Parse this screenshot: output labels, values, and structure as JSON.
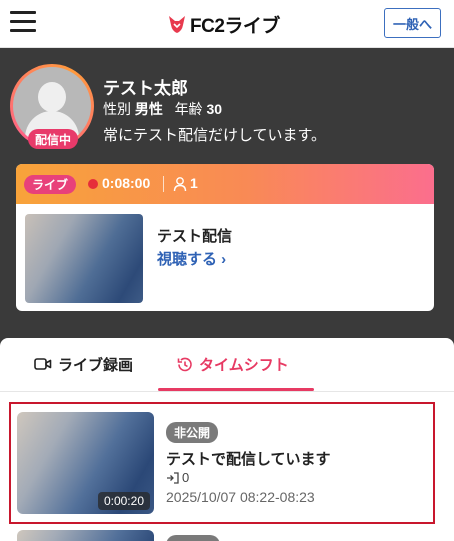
{
  "header": {
    "logo_text": "FC2ライブ",
    "general_button": "一般へ"
  },
  "profile": {
    "name": "テスト太郎",
    "gender_label": "性別",
    "gender_value": "男性",
    "age_label": "年齢",
    "age_value": "30",
    "bio": "常にテスト配信だけしています。",
    "live_badge": "配信中"
  },
  "live_card": {
    "tag": "ライブ",
    "elapsed": "0:08:00",
    "viewers": "1",
    "title": "テスト配信",
    "watch_link": "視聴する ›"
  },
  "tabs": [
    {
      "label": "ライブ録画",
      "active": false
    },
    {
      "label": "タイムシフト",
      "active": true
    }
  ],
  "timeshift_items": [
    {
      "duration": "0:00:20",
      "status": "非公開",
      "title": "テストで配信しています",
      "views": "0",
      "date": "2025/10/07  08:22-08:23"
    }
  ],
  "colors": {
    "accent_pink": "#e73a63",
    "link_blue": "#2f62b5",
    "profile_bg": "#3a3a3a"
  }
}
